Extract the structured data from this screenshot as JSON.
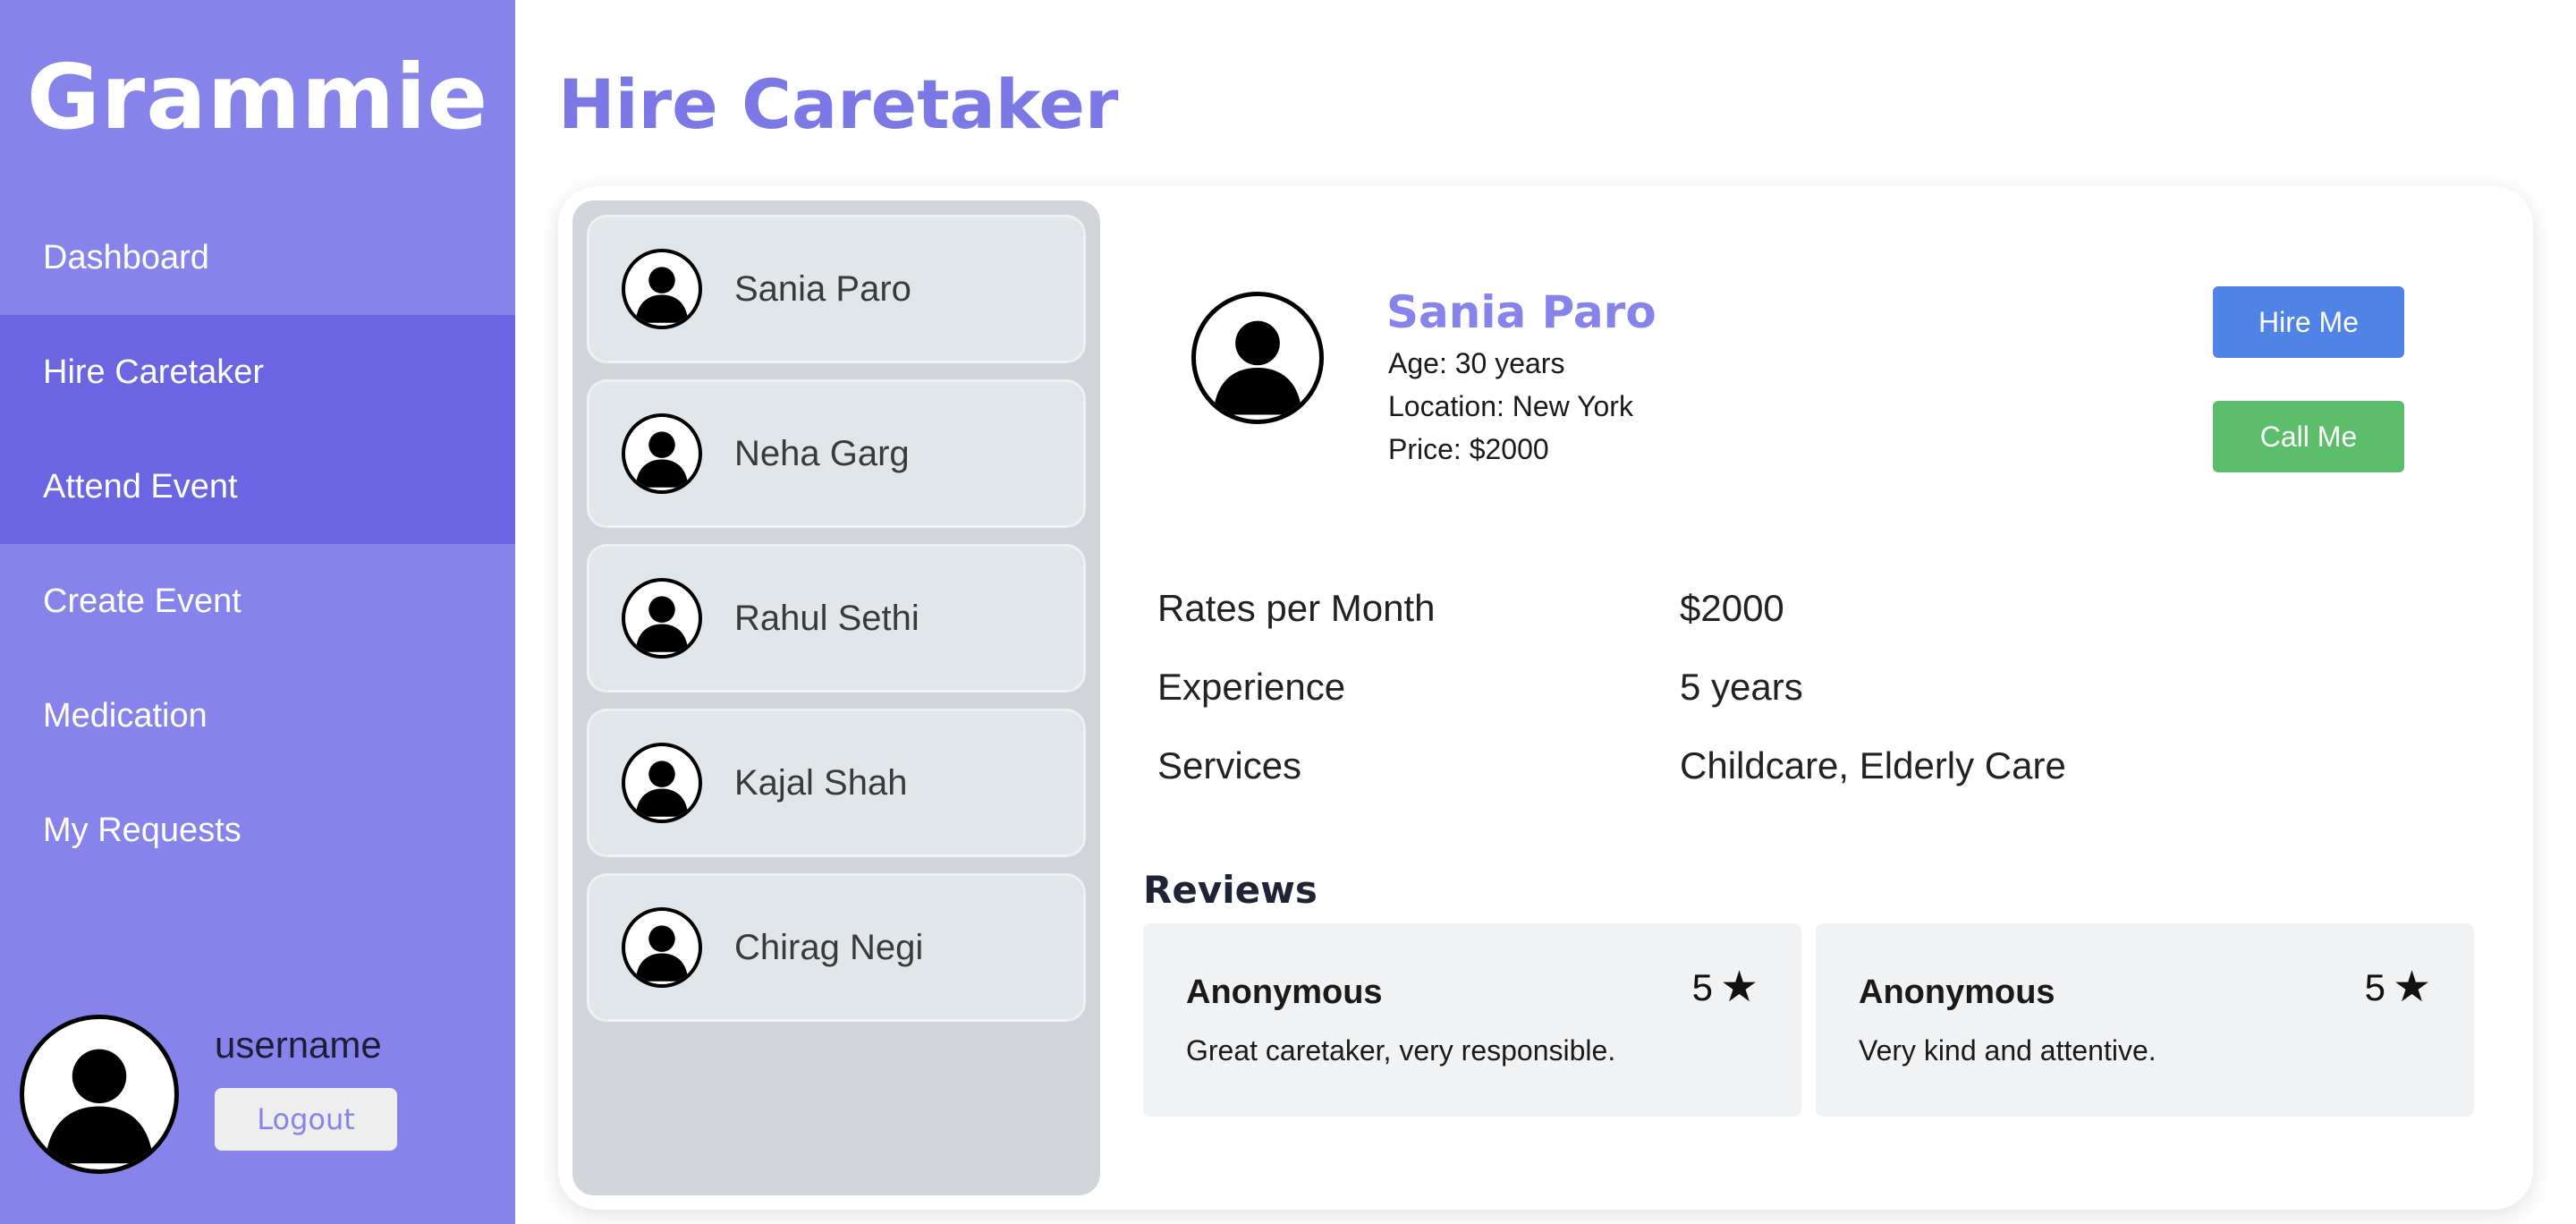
{
  "app": {
    "brand": "Grammie"
  },
  "sidebar": {
    "items": [
      {
        "label": "Dashboard"
      },
      {
        "label": "Hire Caretaker"
      },
      {
        "label": "Attend Event"
      },
      {
        "label": "Create Event"
      },
      {
        "label": "Medication"
      },
      {
        "label": "My Requests"
      }
    ],
    "user": {
      "name": "username",
      "logout_label": "Logout"
    }
  },
  "page": {
    "title": "Hire Caretaker"
  },
  "caretakers": [
    {
      "name": "Sania Paro"
    },
    {
      "name": "Neha Garg"
    },
    {
      "name": "Rahul Sethi"
    },
    {
      "name": "Kajal Shah"
    },
    {
      "name": "Chirag Negi"
    }
  ],
  "profile": {
    "name": "Sania Paro",
    "age": "Age: 30 years",
    "location": "Location: New York",
    "price": "Price: $2000",
    "hire_label": "Hire Me",
    "call_label": "Call Me",
    "details": [
      {
        "label": "Rates per Month",
        "value": "$2000"
      },
      {
        "label": "Experience",
        "value": "5 years"
      },
      {
        "label": "Services",
        "value": "Childcare, Elderly Care"
      }
    ]
  },
  "reviews": {
    "title": "Reviews",
    "items": [
      {
        "author": "Anonymous",
        "rating": "5",
        "text": "Great caretaker, very responsible."
      },
      {
        "author": "Anonymous",
        "rating": "5",
        "text": "Very kind and attentive."
      }
    ]
  },
  "colors": {
    "sidebar": "#8683ea",
    "sidebar_active": "#6b65e2",
    "accent": "#7c79e6",
    "hire_button": "#4f83e6",
    "call_button": "#5cbe6b"
  },
  "icons": {
    "avatar": "user-silhouette-icon",
    "star": "star-icon"
  }
}
